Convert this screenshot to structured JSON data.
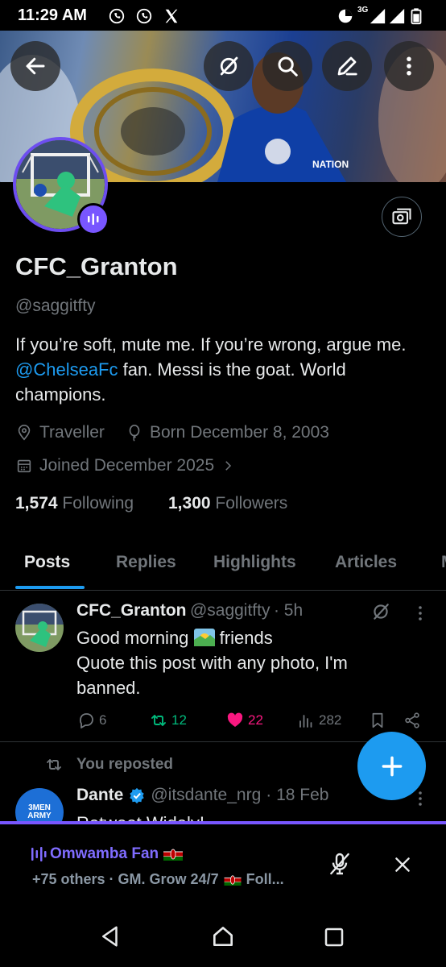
{
  "status_bar": {
    "time": "11:29 AM",
    "network": "3G"
  },
  "header": {
    "back_icon": "arrow-left-icon",
    "buttons": [
      "hide-icon",
      "search-icon",
      "edit-icon",
      "more-vertical-icon"
    ]
  },
  "profile": {
    "display_name": "CFC_Granton",
    "handle": "@saggitfty",
    "bio_part1": "If you’re soft, mute me. If you’re wrong, argue me. ",
    "bio_mention": "@ChelseaFc",
    "bio_part2": " fan. Messi is the goat. World champions.",
    "location": "Traveller",
    "birthday": "Born December 8, 2003",
    "joined": "Joined December 2025",
    "following_count": "1,574",
    "following_label": "Following",
    "followers_count": "1,300",
    "followers_label": "Followers"
  },
  "tabs": [
    {
      "label": "Posts",
      "active": true
    },
    {
      "label": "Replies"
    },
    {
      "label": "Highlights"
    },
    {
      "label": "Articles"
    }
  ],
  "post1": {
    "name": "CFC_Granton",
    "handle": "@saggitfty",
    "time": "· 5h",
    "line1_a": "Good morning",
    "line1_b": "friends",
    "line2": "Quote this post with any photo, I'm banned.",
    "replies": "6",
    "reposts": "12",
    "likes": "22",
    "views": "282"
  },
  "post2": {
    "repost_label": "You reposted",
    "name": "Dante",
    "handle": "@itsdante_nrg",
    "time": "· 18 Feb",
    "text_partial": "Retweet Widely!",
    "avatar_text": "3MEN ARMY"
  },
  "space": {
    "title": "Omwamba Fan",
    "subtitle": "+75 others · GM. Grow 24/7",
    "subtitle_tail": "Foll..."
  },
  "colors": {
    "accent": "#1d9bf0",
    "like": "#f91880",
    "repost": "#00ba7c",
    "spaces": "#7856ff"
  }
}
